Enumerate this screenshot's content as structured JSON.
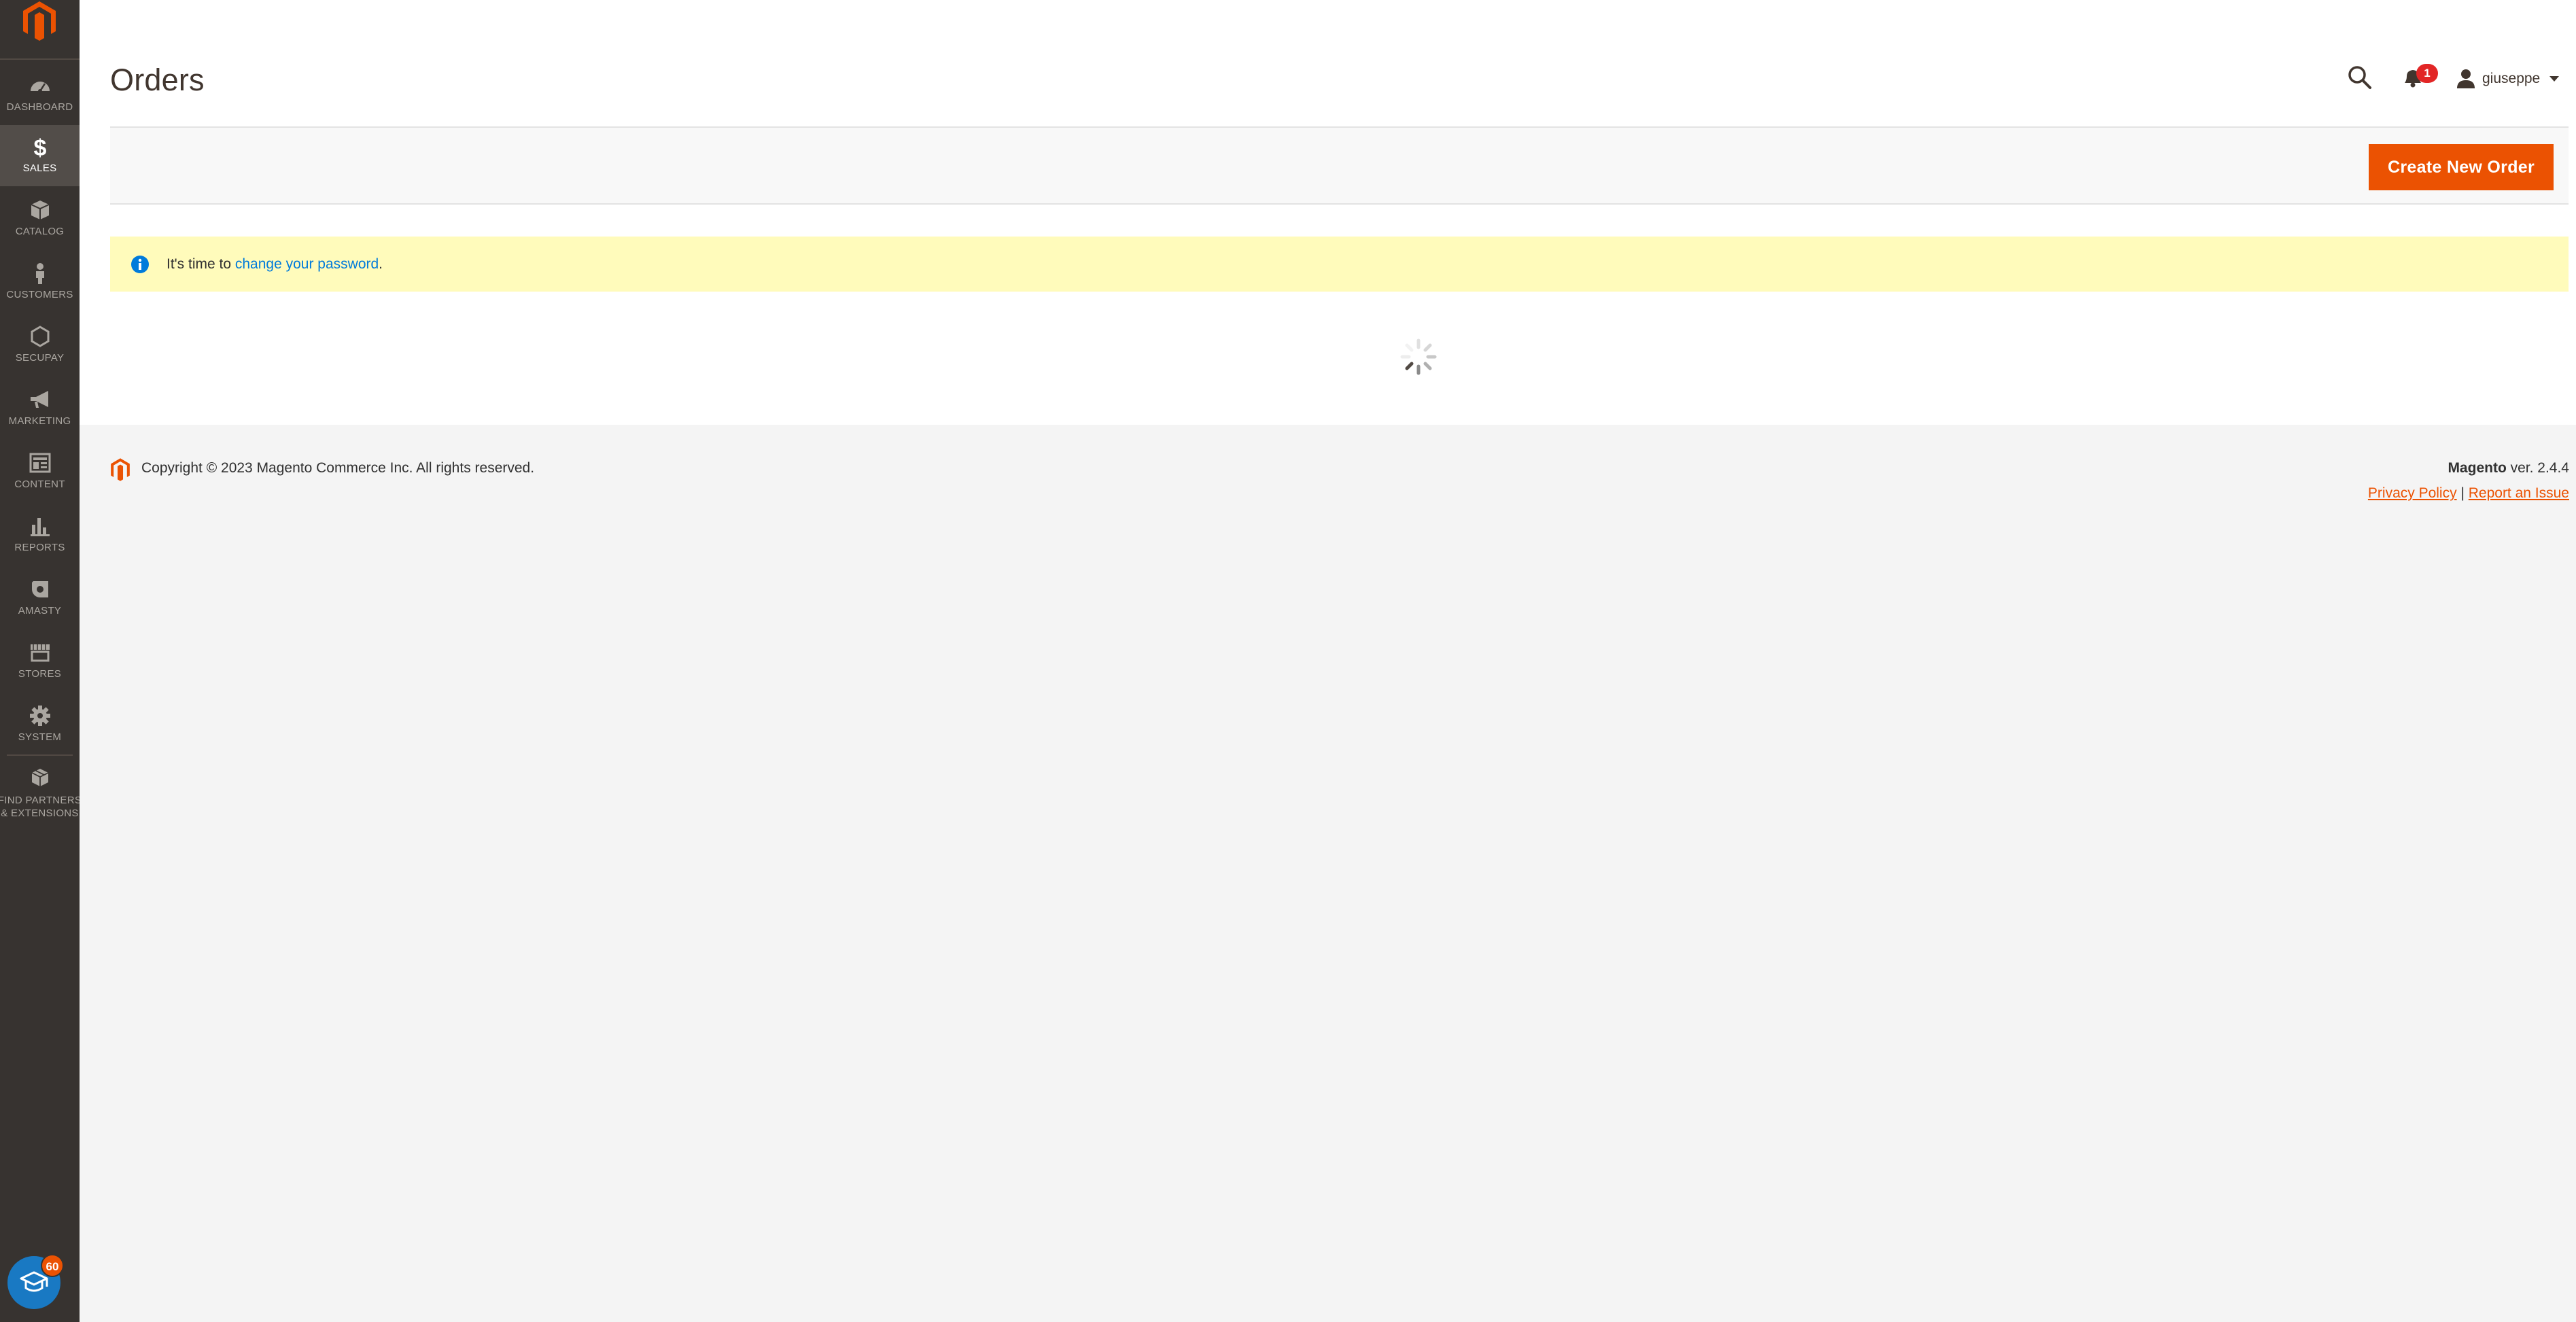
{
  "page": {
    "title": "Orders"
  },
  "sidebar": {
    "items": [
      {
        "id": "dashboard",
        "label": "DASHBOARD",
        "icon": "speedometer-icon",
        "active": false
      },
      {
        "id": "sales",
        "label": "SALES",
        "icon": "dollar-icon",
        "active": true
      },
      {
        "id": "catalog",
        "label": "CATALOG",
        "icon": "box-icon",
        "active": false
      },
      {
        "id": "customers",
        "label": "CUSTOMERS",
        "icon": "person-icon",
        "active": false
      },
      {
        "id": "secupay",
        "label": "SECUPAY",
        "icon": "hexagon-icon",
        "active": false
      },
      {
        "id": "marketing",
        "label": "MARKETING",
        "icon": "megaphone-icon",
        "active": false
      },
      {
        "id": "content",
        "label": "CONTENT",
        "icon": "layout-icon",
        "active": false
      },
      {
        "id": "reports",
        "label": "REPORTS",
        "icon": "bar-chart-icon",
        "active": false
      },
      {
        "id": "amasty",
        "label": "AMASTY",
        "icon": "amasty-icon",
        "active": false
      },
      {
        "id": "stores",
        "label": "STORES",
        "icon": "storefront-icon",
        "active": false
      },
      {
        "id": "system",
        "label": "SYSTEM",
        "icon": "gear-icon",
        "active": false
      },
      {
        "id": "partners",
        "label_line1": "FIND PARTNERS",
        "label_line2": "& EXTENSIONS",
        "icon": "cubes-icon",
        "active": false
      }
    ],
    "education_badge": "60"
  },
  "header": {
    "notifications_count": "1",
    "username": "giuseppe"
  },
  "actions": {
    "create_new_order": "Create New Order"
  },
  "message": {
    "prefix": "It's time to ",
    "link_text": "change your password",
    "suffix": "."
  },
  "footer": {
    "copyright": "Copyright © 2023 Magento Commerce Inc. All rights reserved.",
    "brand": "Magento",
    "version": " ver. 2.4.4",
    "privacy_policy": "Privacy Policy",
    "separator": " | ",
    "report_issue": "Report an Issue"
  },
  "colors": {
    "sidebar_bg": "#373330",
    "sidebar_active": "#524d49",
    "accent": "#eb5202",
    "message_bg": "#fffbbb",
    "link_blue": "#007bdb",
    "badge_red": "#e22626"
  }
}
